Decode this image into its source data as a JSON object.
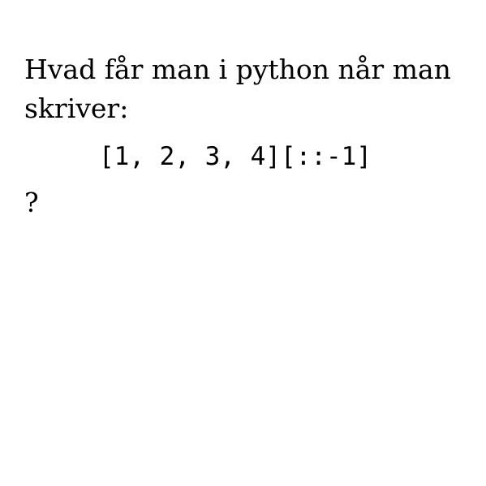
{
  "question": {
    "line1": "Hvad får man i python når man",
    "line2": "skriver:",
    "code": "[1, 2, 3, 4][::-1]",
    "end": "?"
  }
}
